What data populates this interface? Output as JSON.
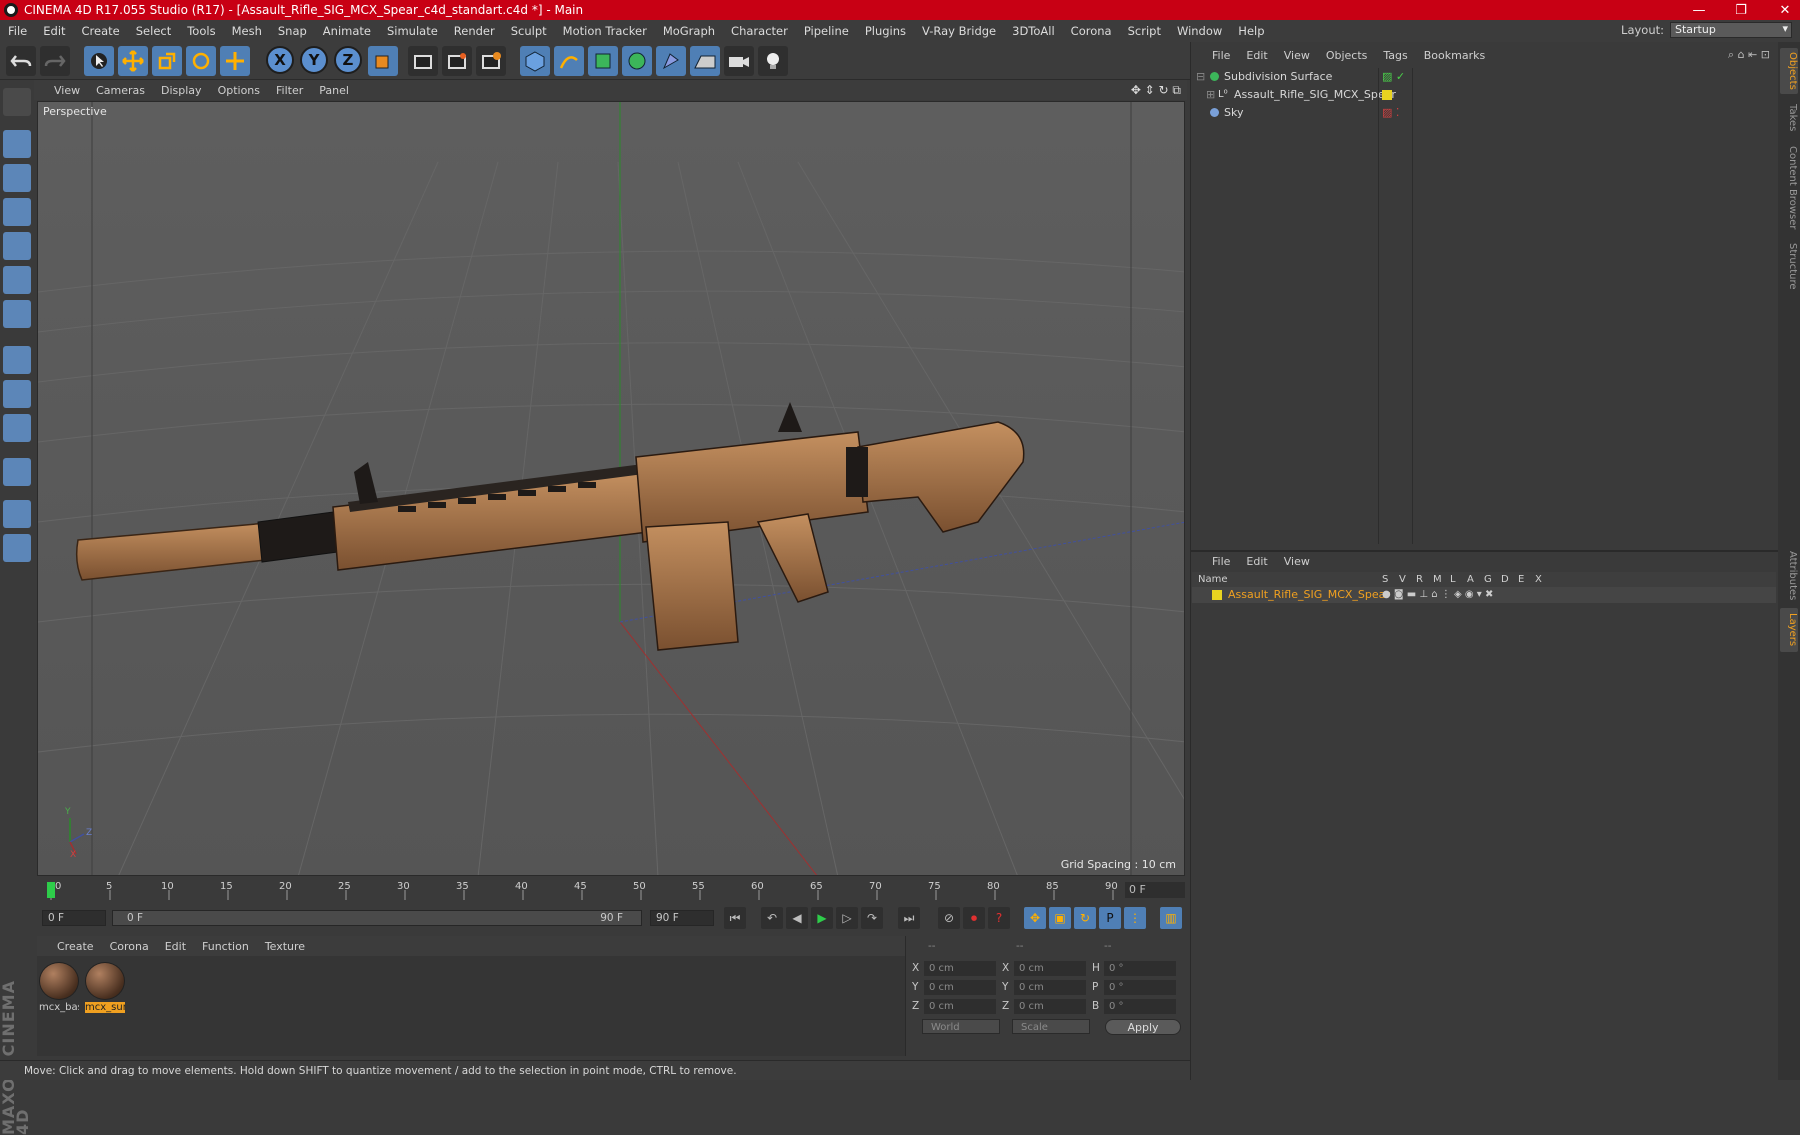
{
  "window": {
    "title": "CINEMA 4D R17.055 Studio (R17) - [Assault_Rifle_SIG_MCX_Spear_c4d_standart.c4d *] - Main",
    "controls": [
      "—",
      "❐",
      "✕"
    ]
  },
  "menu": [
    "File",
    "Edit",
    "Create",
    "Select",
    "Tools",
    "Mesh",
    "Snap",
    "Animate",
    "Simulate",
    "Render",
    "Sculpt",
    "Motion Tracker",
    "MoGraph",
    "Character",
    "Pipeline",
    "Plugins",
    "V-Ray Bridge",
    "3DToAll",
    "Corona",
    "Script",
    "Window",
    "Help"
  ],
  "layout": {
    "label": "Layout:",
    "value": "Startup"
  },
  "toolbar": {
    "axes": [
      "X",
      "Y",
      "Z"
    ]
  },
  "viewport": {
    "menu": [
      "View",
      "Cameras",
      "Display",
      "Options",
      "Filter",
      "Panel"
    ],
    "label": "Perspective",
    "grid_spacing": "Grid Spacing : 10 cm",
    "axis_labels": {
      "y": "Y",
      "z": "Z",
      "x": "X"
    }
  },
  "timeline": {
    "ticks": [
      "0",
      "5",
      "10",
      "15",
      "20",
      "25",
      "30",
      "35",
      "40",
      "45",
      "50",
      "55",
      "60",
      "65",
      "70",
      "75",
      "80",
      "85",
      "90"
    ],
    "current_frame": "0 F",
    "start_field": "0 F",
    "range_start": "0 F",
    "range_end": "90 F",
    "end_field": "90 F"
  },
  "materials": {
    "menu": [
      "Create",
      "Corona",
      "Edit",
      "Function",
      "Texture"
    ],
    "items": [
      {
        "name": "mcx_bas",
        "selected": false
      },
      {
        "name": "mcx_sur",
        "selected": true
      }
    ]
  },
  "coordinates": {
    "headers": [
      "--",
      "--",
      "--"
    ],
    "rows": [
      {
        "l1": "X",
        "v1": "0 cm",
        "l2": "X",
        "v2": "0 cm",
        "l3": "H",
        "v3": "0 °"
      },
      {
        "l1": "Y",
        "v1": "0 cm",
        "l2": "Y",
        "v2": "0 cm",
        "l3": "P",
        "v3": "0 °"
      },
      {
        "l1": "Z",
        "v1": "0 cm",
        "l2": "Z",
        "v2": "0 cm",
        "l3": "B",
        "v3": "0 °"
      }
    ],
    "world": "World",
    "scale": "Scale",
    "apply": "Apply"
  },
  "status": "Move: Click and drag to move elements. Hold down SHIFT to quantize movement / add to the selection in point mode, CTRL to remove.",
  "object_manager": {
    "menu": [
      "File",
      "Edit",
      "View",
      "Objects",
      "Tags",
      "Bookmarks"
    ],
    "objects": [
      {
        "name": "Subdivision Surface",
        "icon_color": "#3cb55a"
      },
      {
        "name": "Assault_Rifle_SIG_MCX_Spear",
        "icon_color": "#cfcfcf",
        "tag_color": "#e8d320"
      },
      {
        "name": "Sky",
        "icon_color": "#7aa0d8"
      }
    ]
  },
  "layer_manager": {
    "menu": [
      "File",
      "Edit",
      "View"
    ],
    "columns": [
      "Name",
      "S",
      "V",
      "R",
      "M",
      "L",
      "A",
      "G",
      "D",
      "E",
      "X"
    ],
    "layers": [
      {
        "name": "Assault_Rifle_SIG_MCX_Spear",
        "color": "#e8d320"
      }
    ]
  },
  "side_tabs": [
    "Objects",
    "Takes",
    "Content Browser",
    "Structure",
    "Attributes",
    "Layers"
  ],
  "logo_text": "MAXON CINEMA 4D"
}
